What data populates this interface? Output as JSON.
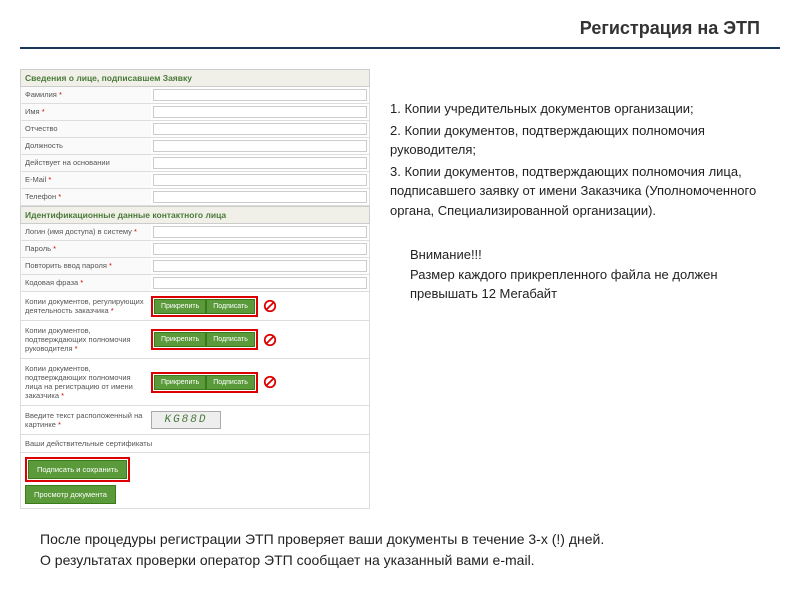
{
  "header": {
    "title": "Регистрация на ЭТП"
  },
  "form": {
    "section1_title": "Сведения о лице, подписавшем Заявку",
    "rows1": [
      {
        "label": "Фамилия",
        "required": true
      },
      {
        "label": "Имя",
        "required": true
      },
      {
        "label": "Отчество",
        "required": false
      },
      {
        "label": "Должность",
        "required": false
      },
      {
        "label": "Действует на основании",
        "required": false
      },
      {
        "label": "E-Mail",
        "required": true
      },
      {
        "label": "Телефон",
        "required": true
      }
    ],
    "section2_title": "Идентификационные данные контактного лица",
    "rows2": [
      {
        "label": "Логин (имя доступа) в систему",
        "required": true
      },
      {
        "label": "Пароль",
        "required": true
      },
      {
        "label": "Повторить ввод пароля",
        "required": true
      },
      {
        "label": "Кодовая фраза",
        "required": true
      }
    ],
    "docs": [
      {
        "label": "Копии документов, регулирующих деятельность заказчика",
        "required": true
      },
      {
        "label": "Копии документов, подтверждающих полномочия руководителя",
        "required": true
      },
      {
        "label": "Копии документов, подтверждающих полномочия лица на регистрацию от имени заказчика",
        "required": true
      }
    ],
    "captcha_label": "Введите текст расположенный на картинке",
    "captcha_value": "KG88D",
    "cert_label": "Ваши действительные сертификаты",
    "attach_btn": "Прикрепить",
    "sign_btn": "Подписать",
    "submit_btn": "Подписать и сохранить",
    "preview_btn": "Просмотр документа"
  },
  "info": {
    "item1": "1. Копии учредительных документов организации;",
    "item2": "2. Копии документов, подтверждающих полномочия руководителя;",
    "item3": "3. Копии документов, подтверждающих полномочия лица, подписавшего заявку от имени Заказчика (Уполномоченного органа, Специализированной организации).",
    "warning_title": "Внимание!!!",
    "warning_text": "Размер каждого прикрепленного файла не должен превышать 12 Мегабайт"
  },
  "footer": {
    "line1": "После процедуры регистрации ЭТП проверяет ваши документы в течение 3-х (!) дней.",
    "line2": "О результатах проверки оператор ЭТП сообщает на указанный вами e-mail."
  }
}
